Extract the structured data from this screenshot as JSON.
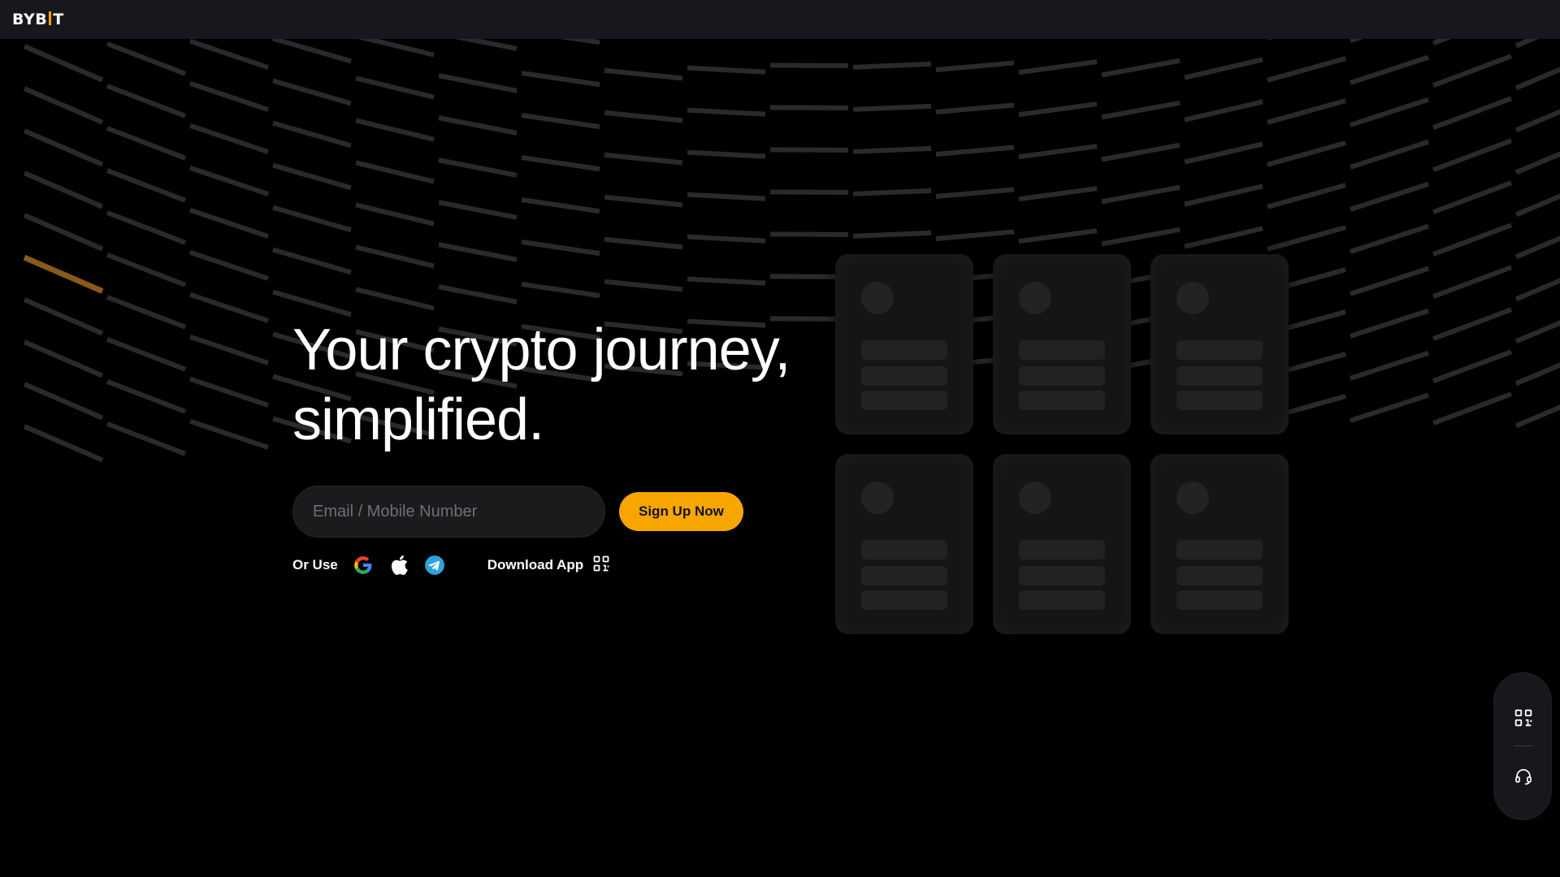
{
  "brand": {
    "logo_left": "BYB",
    "logo_right": "T",
    "accent_color": "#f7a600"
  },
  "hero": {
    "headline_line1": "Your crypto journey,",
    "headline_line2": "simplified."
  },
  "signup": {
    "email_placeholder": "Email / Mobile Number",
    "email_value": "",
    "button_label": "Sign Up Now"
  },
  "alt_login": {
    "label": "Or Use",
    "providers": [
      "google-icon",
      "apple-icon",
      "telegram-icon"
    ],
    "download_label": "Download App",
    "download_icon": "qr-code-icon"
  },
  "float_panel": {
    "items": [
      "qr-code-icon",
      "headset-support-icon"
    ]
  },
  "colors": {
    "background": "#000000",
    "topbar": "#17181d",
    "card": "#151515",
    "button_text": "#121214"
  }
}
